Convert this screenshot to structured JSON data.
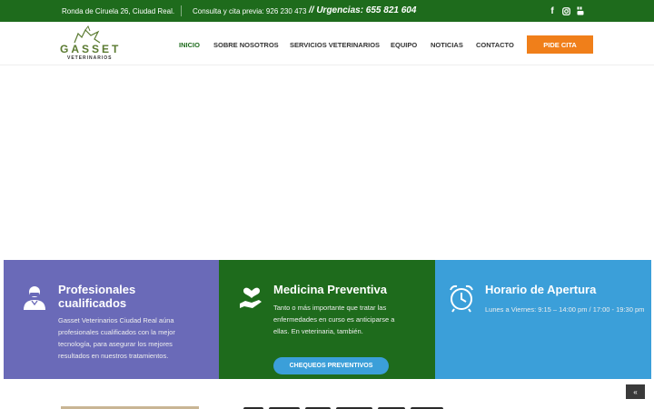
{
  "topbar": {
    "address": "Ronda de Ciruela 26, Ciudad Real.",
    "phone": "Consulta y cita previa: 926 230 473",
    "urgent": "// Urgencias: 655 821 604",
    "social": [
      "facebook-icon",
      "instagram-icon",
      "youtube-icon"
    ],
    "background": "#1e6b1c"
  },
  "logo": {
    "word": "GASSET",
    "sub": "VETERINARIOS"
  },
  "nav": {
    "items": [
      {
        "label": "INICIO",
        "active": true
      },
      {
        "label": "SOBRE NOSOTROS"
      },
      {
        "label": "SERVICIOS VETERINARIOS"
      },
      {
        "label": "EQUIPO"
      },
      {
        "label": "NOTICIAS"
      },
      {
        "label": "CONTACTO"
      }
    ],
    "cta": "PIDE CITA",
    "cta_color": "#f07f1a"
  },
  "cards": [
    {
      "title": "Profesionales cualificados",
      "text": "Gasset Veterinarios Ciudad Real aúna profesionales cualificados con la mejor tecnología, para asegurar los mejores resultados en nuestros tratamientos.",
      "icon": "doctor-icon",
      "color": "#6a6ab8"
    },
    {
      "title": "Medicina Preventiva",
      "text": "Tanto o más importante que tratar las enfermedades en curso es anticiparse a ellas. En veterinaria, también.",
      "button": "CHEQUEOS PREVENTIVOS",
      "icon": "heart-hand-icon",
      "color": "#1e6b1c"
    },
    {
      "title": "Horario de Apertura",
      "text": "Lunes a Viernes: 9:15 – 14:00 pm / 17:00 - 19:30 pm",
      "icon": "alarm-clock-icon",
      "color": "#3b9fd9"
    }
  ],
  "scroll_top": "«"
}
